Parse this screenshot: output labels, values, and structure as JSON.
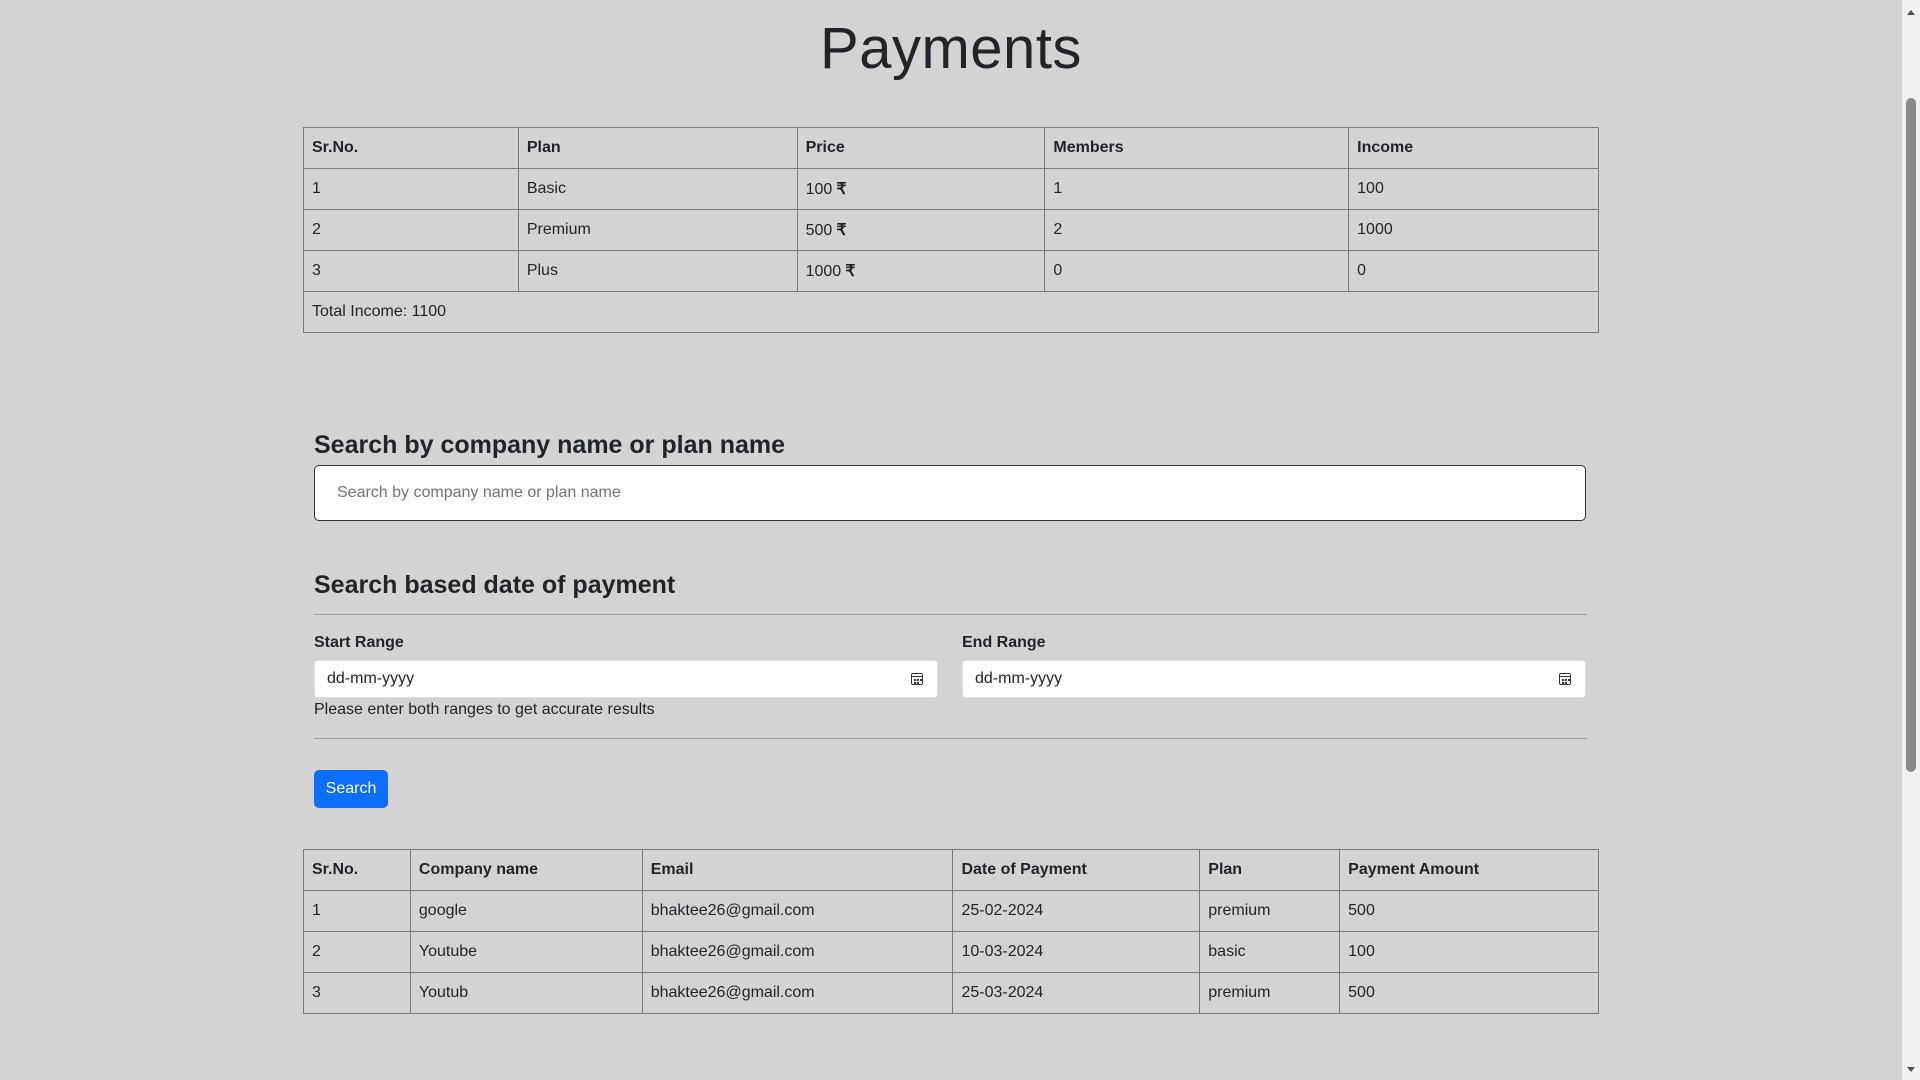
{
  "page": {
    "title": "Payments"
  },
  "plans_table": {
    "headers": [
      "Sr.No.",
      "Plan",
      "Price",
      "Members",
      "Income"
    ],
    "rows": [
      {
        "sr": "1",
        "plan": "Basic",
        "price": "100",
        "members": "1",
        "income": "100"
      },
      {
        "sr": "2",
        "plan": "Premium",
        "price": "500",
        "members": "2",
        "income": "1000"
      },
      {
        "sr": "3",
        "plan": "Plus",
        "price": "1000",
        "members": "0",
        "income": "0"
      }
    ],
    "currency_symbol": "₹",
    "total_income": "Total Income: 1100"
  },
  "search": {
    "heading": "Search by company name or plan name",
    "placeholder": "Search by company name or plan name"
  },
  "date_search": {
    "heading": "Search based date of payment",
    "start_label": "Start Range",
    "start_placeholder": "dd-mm-yyyy",
    "end_label": "End Range",
    "end_placeholder": "dd-mm-yyyy",
    "hint": "Please enter both ranges to get accurate results",
    "button_label": "Search",
    "button_color": "#0d6efd"
  },
  "payments_table": {
    "headers": [
      "Sr.No.",
      "Company name",
      "Email",
      "Date of Payment",
      "Plan",
      "Payment Amount"
    ],
    "rows": [
      {
        "sr": "1",
        "company": "google",
        "email": "bhaktee26@gmail.com",
        "date": "25-02-2024",
        "plan": "premium",
        "amount": "500"
      },
      {
        "sr": "2",
        "company": "Youtube",
        "email": "bhaktee26@gmail.com",
        "date": "10-03-2024",
        "plan": "basic",
        "amount": "100"
      },
      {
        "sr": "3",
        "company": "Youtub",
        "email": "bhaktee26@gmail.com",
        "date": "25-03-2024",
        "plan": "premium",
        "amount": "500"
      }
    ]
  },
  "icons": {
    "calendar": "calendar-icon",
    "currency": "rupee-icon"
  },
  "colors": {
    "background": "#d3d3d3",
    "primary": "#0d6efd"
  }
}
